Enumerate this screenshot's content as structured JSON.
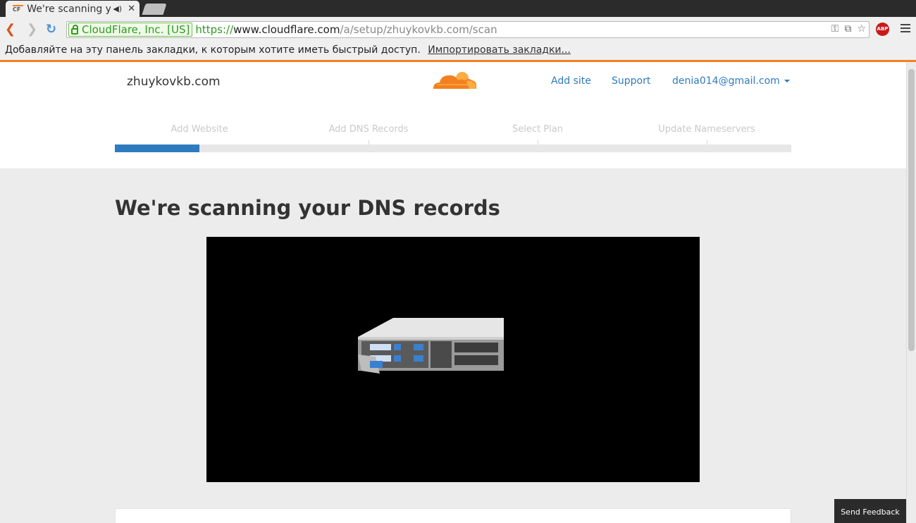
{
  "browser": {
    "tab_title": "We're scanning your DNS records",
    "favicon_label": "CF",
    "close_glyph": "✕",
    "speaker_glyph": "◀)",
    "ev_label": "CloudFlare, Inc. [US]",
    "url_scheme": "https://",
    "url_host": "www.cloudflare.com",
    "url_path": "/a/setup/zhuykovkb.com/scan",
    "back_glyph": "❮",
    "forward_glyph": "❯",
    "reload_glyph": "↻",
    "abp_label": "ABP",
    "omni_icons": [
      "⚿",
      "⧉",
      "☆"
    ]
  },
  "bookmarks_bar": {
    "message": "Добавляйте на эту панель закладки, к которым хотите иметь быстрый доступ.",
    "import_link": "Импортировать закладки..."
  },
  "header": {
    "domain": "zhuykovkb.com",
    "nav": {
      "add_site": "Add site",
      "support": "Support",
      "user_email": "denia014@gmail.com"
    }
  },
  "steps": [
    {
      "label": "Add Website"
    },
    {
      "label": "Add DNS Records"
    },
    {
      "label": "Select Plan"
    },
    {
      "label": "Update Nameservers"
    }
  ],
  "progress": {
    "fraction": 0.125
  },
  "main": {
    "heading": "We're scanning your DNS records"
  },
  "feedback": {
    "label": "Send Feedback"
  },
  "colors": {
    "brand_orange": "#f38020",
    "link_blue": "#2f7bbf",
    "progress_blue": "#2f7bbf",
    "ev_green": "#2e9b20"
  }
}
